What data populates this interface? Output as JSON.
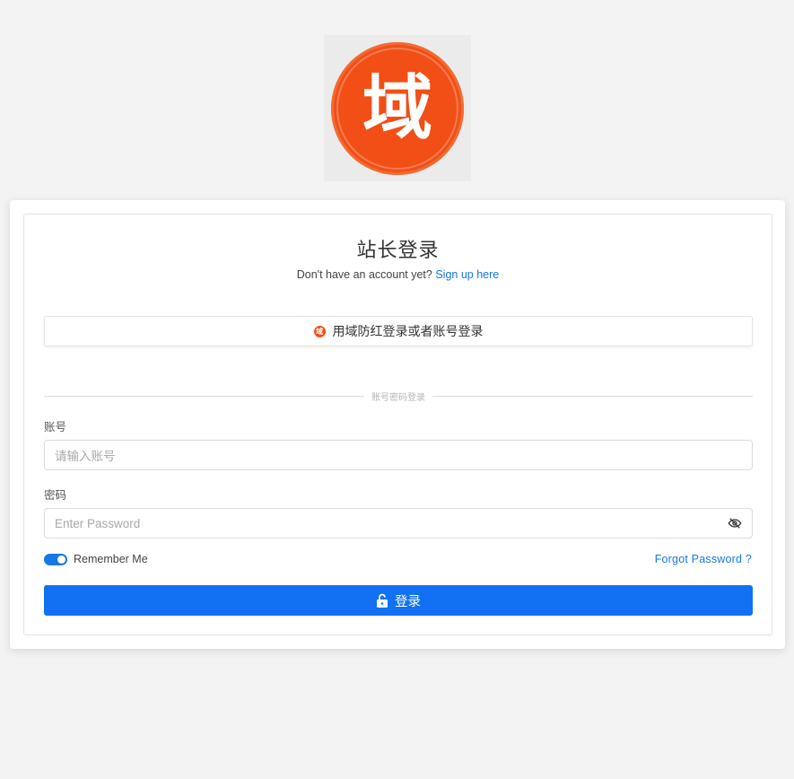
{
  "logo": {
    "char": "域",
    "color": "#f14f16"
  },
  "header": {
    "title": "站长登录",
    "subtitle_text": "Don't have an account yet?",
    "signup_link": "Sign up here"
  },
  "oauth": {
    "label": "用域防红登录或者账号登录",
    "mini_logo_char": "域"
  },
  "divider": {
    "text": "账号密码登录"
  },
  "form": {
    "account_label": "账号",
    "account_placeholder": "请输入账号",
    "password_label": "密码",
    "password_placeholder": "Enter Password",
    "remember_label": "Remember Me",
    "remember_checked": true,
    "forgot_label": "Forgot Password ?",
    "submit_label": "登录"
  },
  "colors": {
    "accent": "#1271f2",
    "link": "#1677e6",
    "brand": "#f14f16"
  },
  "icons": {
    "password_toggle": "eye-off-icon",
    "submit": "unlock-icon"
  }
}
